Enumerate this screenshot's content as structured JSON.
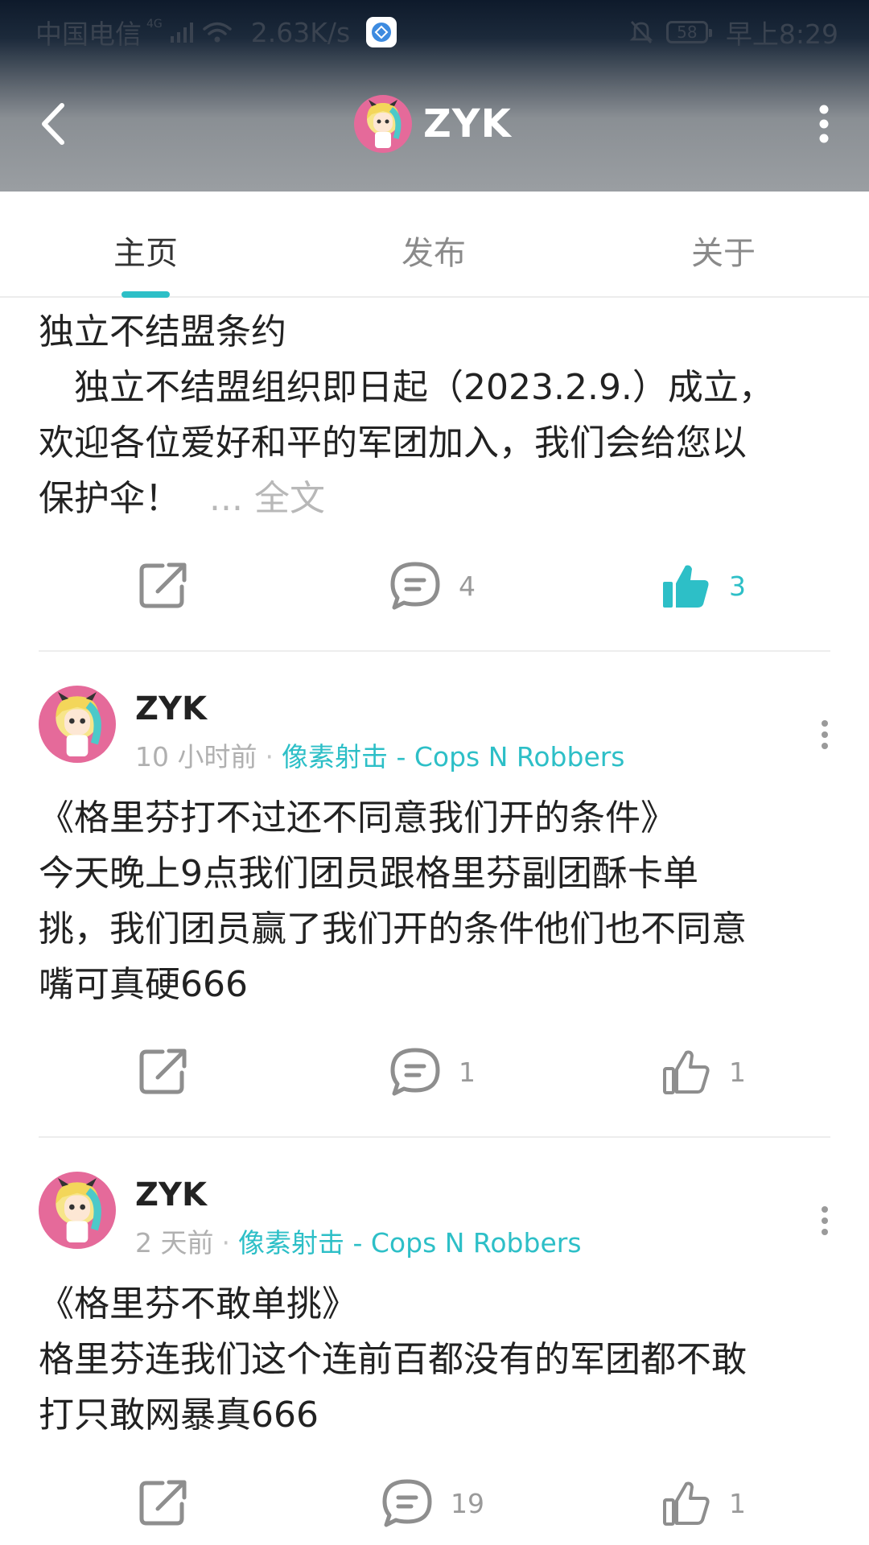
{
  "status_bar": {
    "carrier": "中国电信",
    "network_type": "4G",
    "net_speed": "2.63K/s",
    "battery": "58",
    "time": "早上8:29"
  },
  "title_bar": {
    "title": "ZYK",
    "back_icon": "chevron-left-icon",
    "more_icon": "more-vertical-icon"
  },
  "tabs": [
    {
      "label": "主页",
      "active": true
    },
    {
      "label": "发布",
      "active": false
    },
    {
      "label": "关于",
      "active": false
    }
  ],
  "accent_color": "#2dbfc7",
  "posts": [
    {
      "title": "独立不结盟条约",
      "body_lines": [
        "　独立不结盟组织即日起（2023.2.9.）成立，",
        "欢迎各位爱好和平的军团加入，我们会给您以",
        "保护伞！"
      ],
      "more_label": "... 全文",
      "comments": "4",
      "likes": "3",
      "liked": true
    },
    {
      "author": "ZYK",
      "time": "10 小时前",
      "separator": "·",
      "game": "像素射击 - Cops N Robbers",
      "title": "《格里芬打不过还不同意我们开的条件》",
      "body_lines": [
        "今天晚上9点我们团员跟格里芬副团酥卡单",
        "挑，我们团员赢了我们开的条件他们也不同意",
        "嘴可真硬666"
      ],
      "comments": "1",
      "likes": "1",
      "liked": false
    },
    {
      "author": "ZYK",
      "time": "2 天前",
      "separator": "·",
      "game": "像素射击 - Cops N Robbers",
      "title": "《格里芬不敢单挑》",
      "body_lines": [
        "格里芬连我们这个连前百都没有的军团都不敢",
        "打只敢网暴真666"
      ],
      "comments": "19",
      "likes": "1",
      "liked": false
    }
  ]
}
